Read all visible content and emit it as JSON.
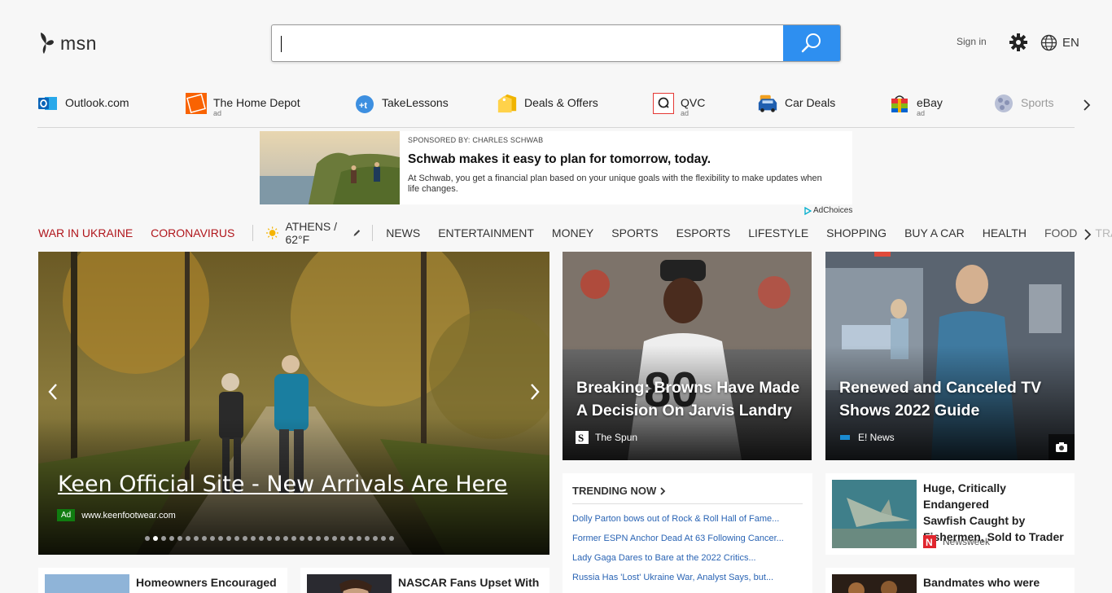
{
  "header": {
    "logo_text": "msn",
    "search_placeholder": "",
    "sign_in": "Sign in",
    "language": "EN"
  },
  "quick_links": [
    {
      "label": "Outlook.com",
      "ad": ""
    },
    {
      "label": "The Home Depot",
      "ad": "ad"
    },
    {
      "label": "TakeLessons",
      "ad": ""
    },
    {
      "label": "Deals & Offers",
      "ad": ""
    },
    {
      "label": "QVC",
      "ad": "ad"
    },
    {
      "label": "Car Deals",
      "ad": ""
    },
    {
      "label": "eBay",
      "ad": "ad"
    },
    {
      "label": "Sports",
      "ad": ""
    }
  ],
  "sponsor": {
    "by": "SPONSORED BY: CHARLES SCHWAB",
    "headline": "Schwab makes it easy to plan for tomorrow, today.",
    "description": "At Schwab, you get a financial plan based on your unique goals with the flexibility to make updates when life changes.",
    "adchoices": "AdChoices"
  },
  "nav": {
    "highlight": [
      "WAR IN UKRAINE",
      "CORONAVIRUS"
    ],
    "weather": "ATHENS / 62°F",
    "items": [
      "NEWS",
      "ENTERTAINMENT",
      "MONEY",
      "SPORTS",
      "ESPORTS",
      "LIFESTYLE",
      "SHOPPING",
      "BUY A CAR",
      "HEALTH",
      "FOOD",
      "TRAVEL"
    ]
  },
  "hero": {
    "title": "Keen Official Site - New Arrivals Are Here",
    "ad_badge": "Ad",
    "ad_source": "www.keenfootwear.com",
    "slide_count": 31,
    "active_slide": 2
  },
  "cards": [
    {
      "title_line1": "Breaking: Browns Have Made",
      "title_line2": "A Decision On Jarvis Landry",
      "source": "The Spun"
    },
    {
      "title_line1": "Renewed and Canceled TV",
      "title_line2": "Shows 2022 Guide",
      "source": "E! News"
    }
  ],
  "trending": {
    "header": "TRENDING NOW",
    "items": [
      "Dolly Parton bows out of Rock & Roll Hall of Fame...",
      "Former ESPN Anchor Dead At 63 Following Cancer...",
      "Lady Gaga Dares to Bare at the 2022 Critics...",
      "Russia Has 'Lost' Ukraine War, Analyst Says, but..."
    ]
  },
  "stories": [
    {
      "title_line1": "Huge, Critically Endangered",
      "title_line2": "Sawfish Caught by",
      "title_line3": "Fishermen, Sold to Trader",
      "source": "Newsweek"
    },
    {
      "title_line1": "Bandmates who were"
    },
    {
      "title_line1": "Homeowners Encouraged to"
    },
    {
      "title_line1": "NASCAR Fans Upset With"
    }
  ]
}
